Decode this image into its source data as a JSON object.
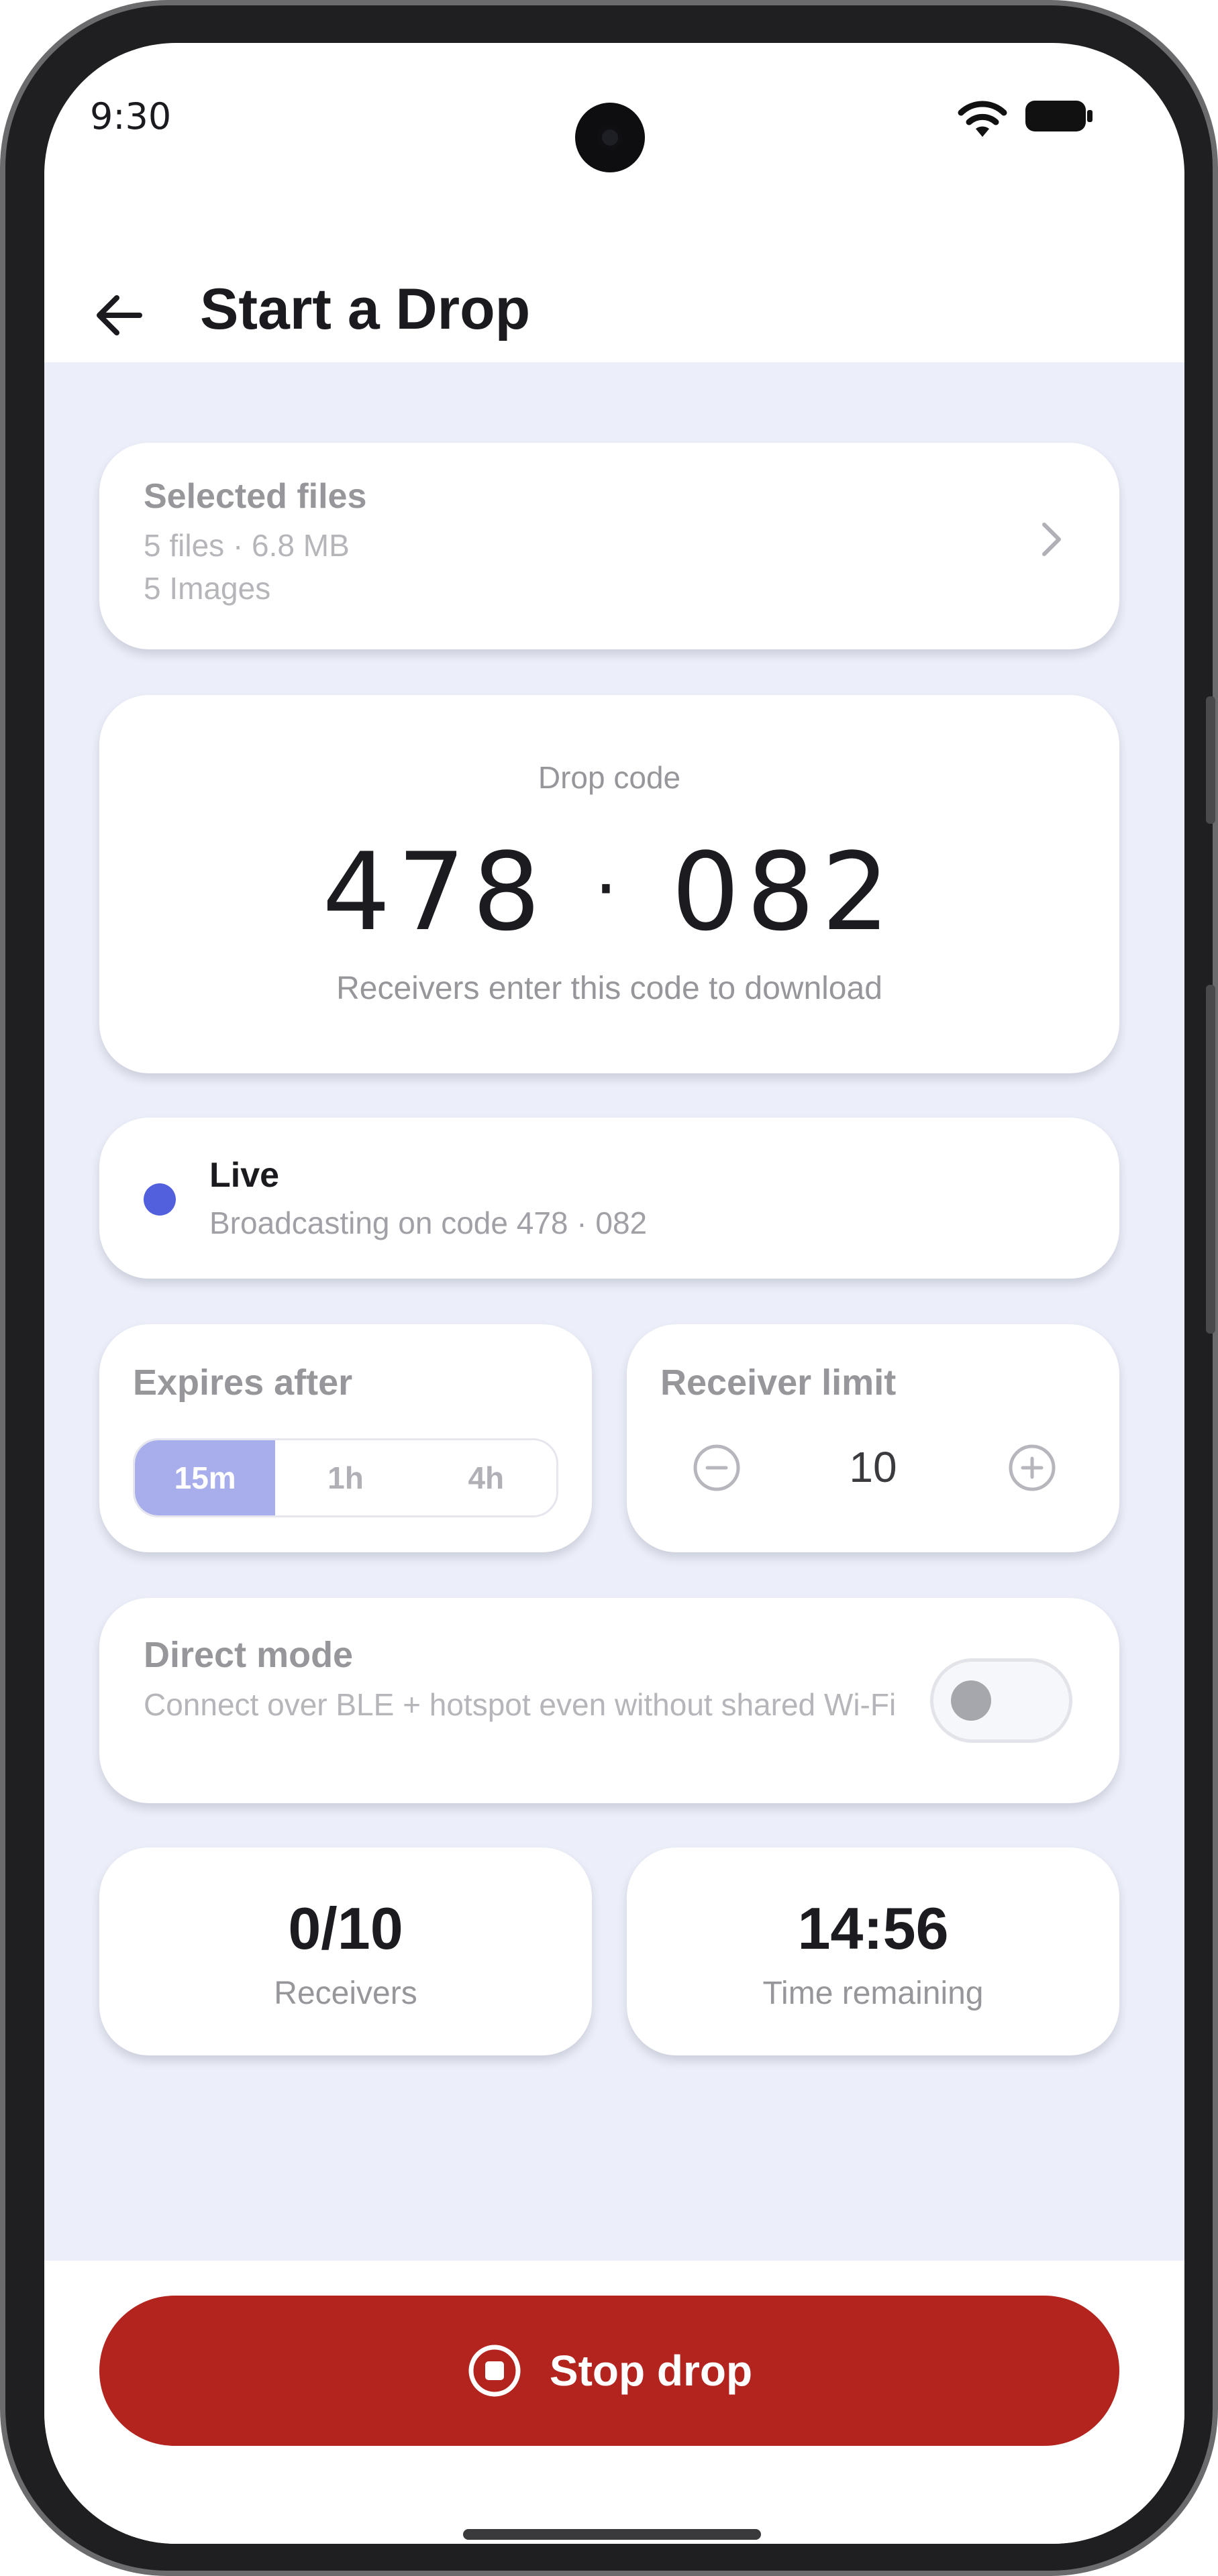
{
  "status_bar": {
    "time": "9:30",
    "wifi_icon": "wifi-icon",
    "battery_icon": "battery-icon"
  },
  "app_bar": {
    "back_icon": "arrow-left-icon",
    "title": "Start a Drop"
  },
  "selected_files": {
    "title": "Selected files",
    "summary": "5 files · 6.8 MB",
    "detail": "5 Images",
    "chevron_icon": "chevron-right-icon"
  },
  "drop_code": {
    "label": "Drop code",
    "part1": "478",
    "separator": "·",
    "part2": "082",
    "hint": "Receivers enter this code to download"
  },
  "live": {
    "title": "Live",
    "subtitle": "Broadcasting on code 478 · 082",
    "indicator_color": "#5360dd"
  },
  "expires": {
    "title": "Expires after",
    "options": [
      "15m",
      "1h",
      "4h"
    ],
    "selected": "15m"
  },
  "receiver_limit": {
    "title": "Receiver limit",
    "value": "10",
    "minus_icon": "minus-circle-icon",
    "plus_icon": "plus-circle-icon"
  },
  "direct_mode": {
    "title": "Direct mode",
    "subtitle": "Connect over BLE + hotspot even without shared Wi-Fi",
    "enabled": false
  },
  "stats": {
    "receivers_value": "0/10",
    "receivers_label": "Receivers",
    "time_value": "14:56",
    "time_label": "Time remaining"
  },
  "stop_button": {
    "label": "Stop drop",
    "icon": "stop-circle-icon",
    "color": "#b3241e"
  },
  "colors": {
    "background": "#eceff9",
    "accent": "#5360dd",
    "segment_selected": "#a8aeeb"
  }
}
